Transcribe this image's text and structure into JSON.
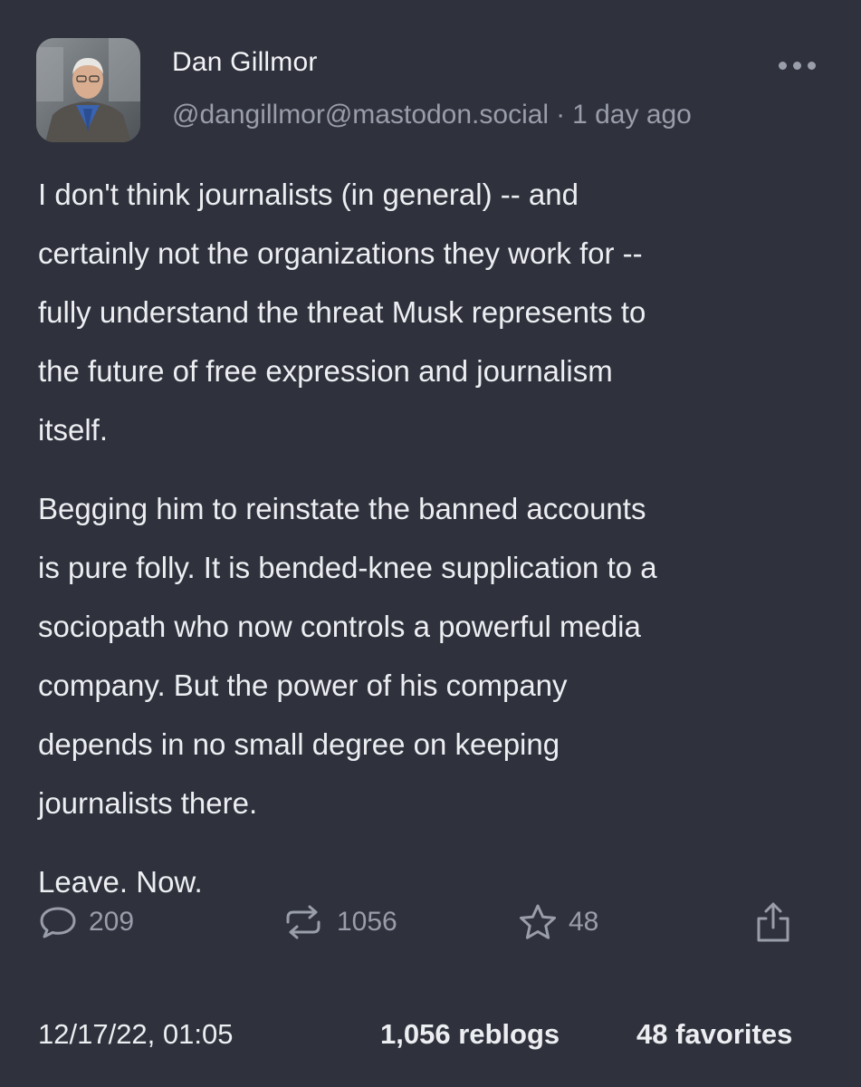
{
  "post": {
    "author": {
      "display_name": "Dan Gillmor",
      "handle": "@dangillmor@mastodon.social"
    },
    "relative_time": "1 day ago",
    "meta_separator": "·",
    "paragraphs": [
      "I don't think journalists (in general) -- and\ncertainly not the organizations they work for --\nfully understand the threat Musk represents to\nthe future of free expression and journalism\nitself.",
      "Begging him to reinstate the banned accounts\nis pure folly. It is bended-knee supplication to a\nsociopath who now controls a powerful media\ncompany. But the power of his company\ndepends in no small degree on keeping\njournalists there.",
      "Leave. Now."
    ]
  },
  "actions": {
    "reply": {
      "icon": "reply-icon",
      "count": "209"
    },
    "reblog": {
      "icon": "reblog-icon",
      "count": "1056"
    },
    "favorite": {
      "icon": "star-icon",
      "count": "48"
    },
    "share": {
      "icon": "share-icon"
    }
  },
  "footer": {
    "timestamp": "12/17/22, 01:05",
    "reblogs": "1,056 reblogs",
    "favorites": "48 favorites"
  },
  "colors": {
    "background": "#2f323c",
    "text": "#eceef2",
    "muted": "#9a9daa"
  }
}
